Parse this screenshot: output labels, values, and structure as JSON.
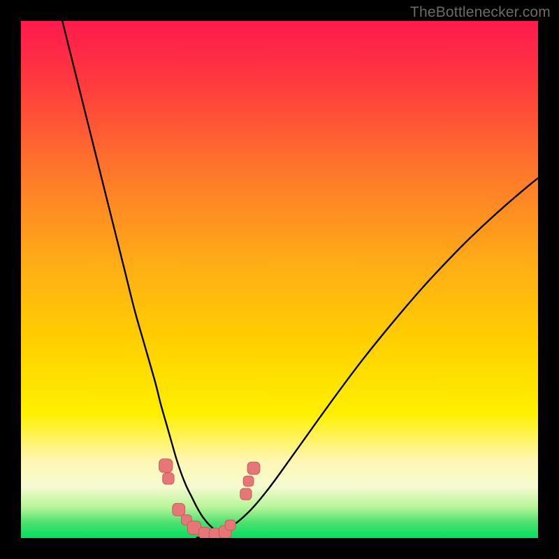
{
  "watermark": "TheBottlenecker.com",
  "colors": {
    "top": "#ff1a4d",
    "mid": "#ffd000",
    "cream": "#fff6b3",
    "green": "#00e060",
    "curve": "#000000",
    "dots": "#e77676",
    "dots_stroke": "#c75d5d"
  },
  "chart_data": {
    "type": "line",
    "title": "",
    "xlabel": "",
    "ylabel": "",
    "xlim": [
      0,
      100
    ],
    "ylim": [
      0,
      100
    ],
    "grid": false,
    "notes": "Background is a vertical rainbow gradient (red→orange→yellow→pale→green). Two black curves descend from upper-left and upper-right into a shared minimum near x≈36, y≈0. A cluster of salmon squircle markers sits around the minimum.",
    "series": [
      {
        "name": "left-curve",
        "x": [
          8,
          10,
          12,
          14,
          16,
          18,
          20,
          22,
          24,
          26,
          27,
          28,
          29,
          30,
          31,
          32,
          33,
          34,
          35,
          36,
          37,
          38,
          39,
          40
        ],
        "y": [
          100,
          92,
          84,
          76,
          68,
          60,
          52,
          44,
          37,
          30,
          26,
          22.5,
          19,
          15.5,
          12.5,
          10,
          8,
          6,
          4.3,
          3,
          2,
          1.2,
          0.6,
          0.2
        ]
      },
      {
        "name": "right-curve",
        "x": [
          34,
          36,
          38,
          40,
          42,
          44,
          46,
          48,
          50,
          54,
          58,
          62,
          66,
          70,
          74,
          78,
          82,
          86,
          90,
          94,
          98,
          100
        ],
        "y": [
          0.1,
          0.3,
          0.8,
          1.8,
          3.2,
          5.0,
          7.2,
          9.7,
          12.4,
          18.0,
          23.6,
          29.1,
          34.4,
          39.4,
          44.2,
          48.8,
          53.1,
          57.2,
          61.0,
          64.6,
          68.0,
          69.6
        ]
      }
    ],
    "markers": [
      {
        "x": 28.0,
        "y": 14.0,
        "size": 2.6
      },
      {
        "x": 28.5,
        "y": 11.5,
        "size": 2.2
      },
      {
        "x": 30.5,
        "y": 5.5,
        "size": 2.4
      },
      {
        "x": 32.0,
        "y": 3.5,
        "size": 2.0
      },
      {
        "x": 33.5,
        "y": 2.0,
        "size": 2.6
      },
      {
        "x": 35.5,
        "y": 1.0,
        "size": 2.2
      },
      {
        "x": 37.5,
        "y": 0.8,
        "size": 2.2
      },
      {
        "x": 39.5,
        "y": 1.2,
        "size": 2.4
      },
      {
        "x": 40.5,
        "y": 2.5,
        "size": 2.0
      },
      {
        "x": 43.5,
        "y": 8.5,
        "size": 2.2
      },
      {
        "x": 44.0,
        "y": 11.0,
        "size": 2.0
      },
      {
        "x": 45.0,
        "y": 13.5,
        "size": 2.4
      }
    ]
  }
}
